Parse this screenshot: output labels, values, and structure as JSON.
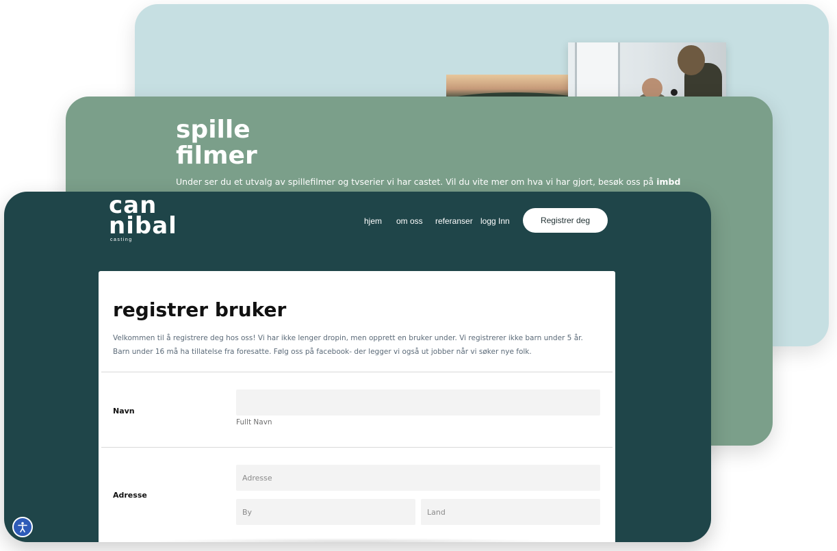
{
  "films": {
    "title_line1": "spille",
    "title_line2": "filmer",
    "description": "Under ser du et utvalg av spillefilmer og tvserier vi har castet. Vil du vite mer om hva vi har gjort, besøk oss på ",
    "description_link": "imbd"
  },
  "header": {
    "logo_line1": "can",
    "logo_line2": "nibal",
    "logo_sub": "casting",
    "nav": [
      "hjem",
      "om oss",
      "referanser",
      "logg Inn"
    ],
    "register_button": "Registrer deg"
  },
  "form": {
    "title": "registrer bruker",
    "intro": "Velkommen til å registrere deg hos oss! Vi har ikke lenger dropin, men opprett en bruker under. Vi registrerer ikke barn under 5 år. Barn under 16 må ha tillatelse fra foresatte. Følg oss på facebook- der legger vi også ut jobber når vi søker nye folk.",
    "name": {
      "label": "Navn",
      "value": "",
      "help": "Fullt Navn"
    },
    "address": {
      "label": "Adresse",
      "address_placeholder": "Adresse",
      "city_placeholder": "By",
      "country_placeholder": "Land"
    }
  },
  "colors": {
    "back_card": "#c6dfe2",
    "mid_card": "#7b9f8a",
    "front_card": "#1f4549"
  },
  "icons": {
    "accessibility": "accessibility-icon"
  }
}
